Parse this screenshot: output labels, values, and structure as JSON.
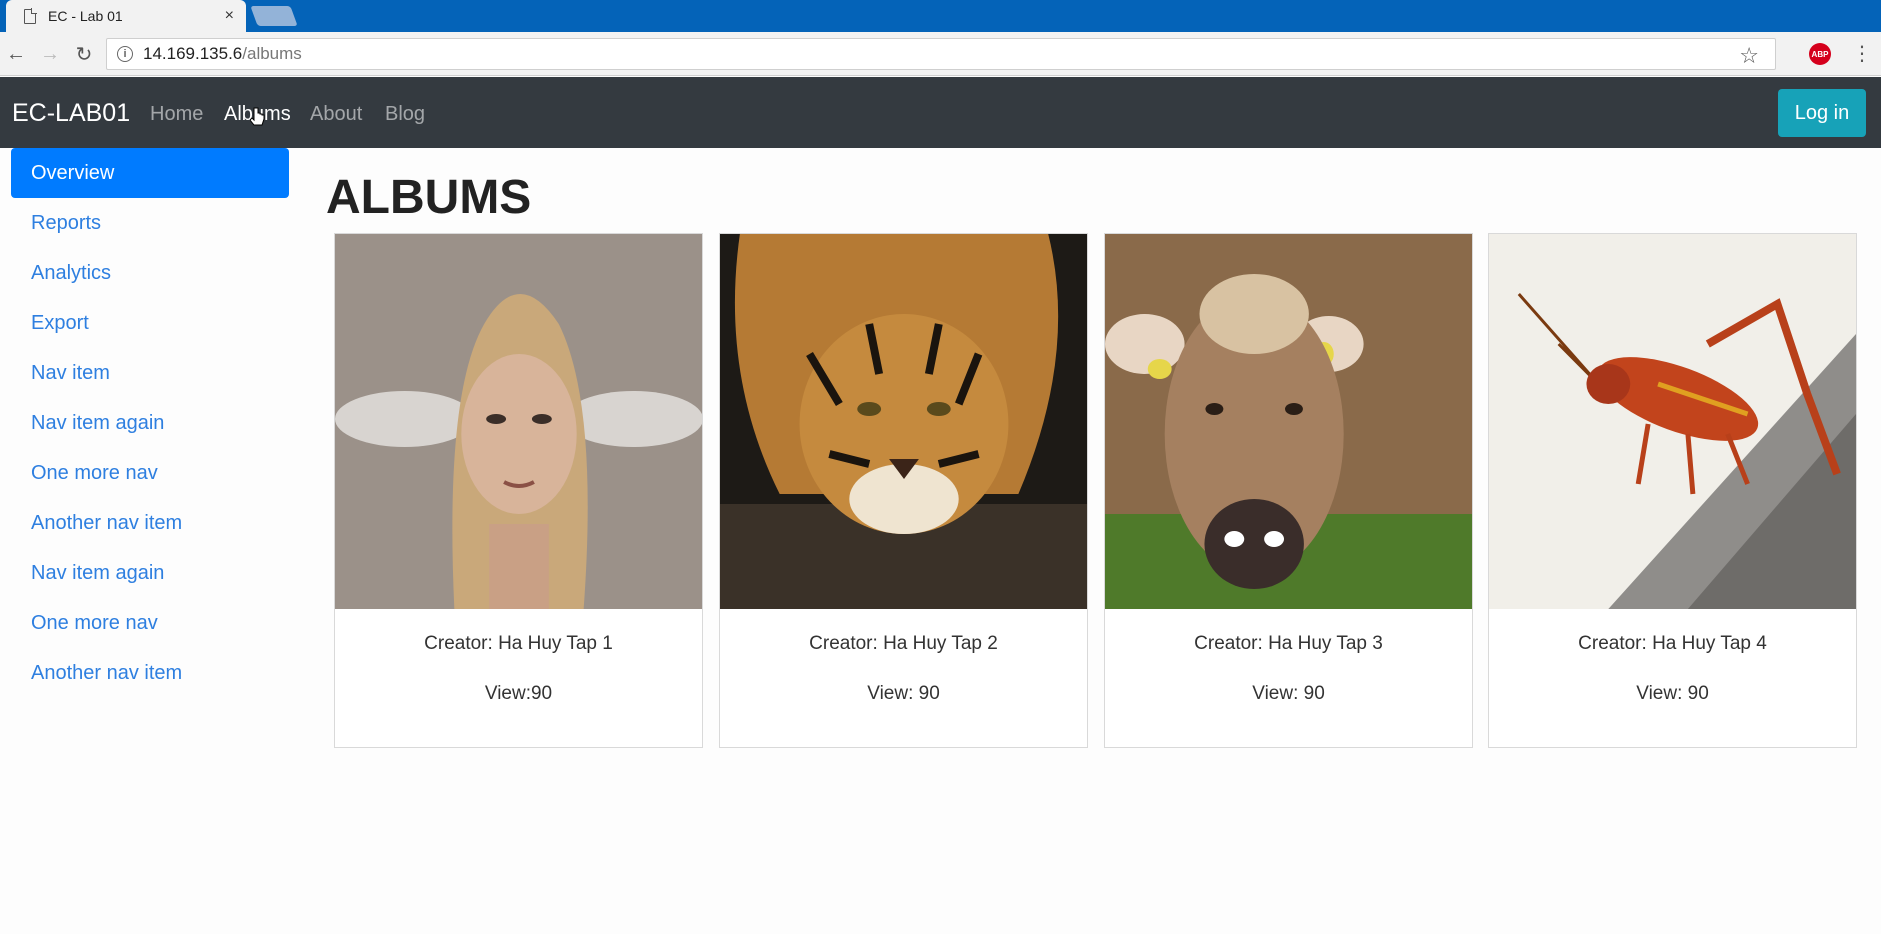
{
  "browser": {
    "tab_title": "EC - Lab 01",
    "tab_close": "×",
    "url_host": "14.169.135.6",
    "url_path": "/albums",
    "abp_label": "ABP",
    "icons": {
      "back": "←",
      "forward": "→",
      "reload": "↻",
      "star": "☆",
      "menu": "⋮",
      "info": "i"
    }
  },
  "navbar": {
    "brand": "EC-LAB01",
    "links": [
      {
        "label": "Home"
      },
      {
        "label": "Albums"
      },
      {
        "label": "About"
      },
      {
        "label": "Blog"
      }
    ],
    "active_link": "Albums",
    "login_label": "Log in"
  },
  "sidebar": {
    "items": [
      {
        "label": "Overview"
      },
      {
        "label": "Reports"
      },
      {
        "label": "Analytics"
      },
      {
        "label": "Export"
      },
      {
        "label": "Nav item"
      },
      {
        "label": "Nav item again"
      },
      {
        "label": "One more nav"
      },
      {
        "label": "Another nav item"
      },
      {
        "label": "Nav item again"
      },
      {
        "label": "One more nav"
      },
      {
        "label": "Another nav item"
      }
    ],
    "active_item": "Overview"
  },
  "main": {
    "title": "ALBUMS",
    "albums": [
      {
        "creator": "Creator: Ha Huy Tap 1",
        "views": "View:90",
        "image": "woman-portrait"
      },
      {
        "creator": "Creator: Ha Huy Tap 2",
        "views": "View: 90",
        "image": "tiger"
      },
      {
        "creator": "Creator: Ha Huy Tap 3",
        "views": "View: 90",
        "image": "cow"
      },
      {
        "creator": "Creator: Ha Huy Tap 4",
        "views": "View: 90",
        "image": "grasshopper"
      }
    ]
  },
  "colors": {
    "tabstrip": "#0463b8",
    "navbar": "#343a40",
    "primary": "#007bff",
    "login": "#17a2b8",
    "sidebar_link": "#2e7fe0"
  }
}
